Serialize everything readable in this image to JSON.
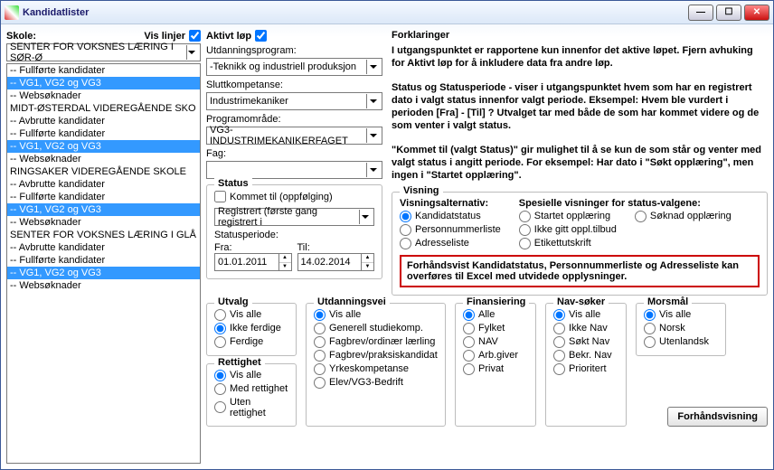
{
  "window": {
    "title": "Kandidatlister"
  },
  "left": {
    "skole_label": "Skole:",
    "vis_linjer_label": "Vis linjer",
    "skole_value": "SENTER FOR VOKSNES LÆRING I SØR-Ø",
    "items": [
      {
        "t": "-- Fullførte kandidater",
        "sel": false
      },
      {
        "t": "-- VG1, VG2 og VG3",
        "sel": true
      },
      {
        "t": "-- Websøknader",
        "sel": false
      },
      {
        "t": "MIDT-ØSTERDAL VIDEREGÅENDE SKO",
        "sel": false
      },
      {
        "t": "-- Avbrutte kandidater",
        "sel": false
      },
      {
        "t": "-- Fullførte kandidater",
        "sel": false
      },
      {
        "t": "-- VG1, VG2 og VG3",
        "sel": true
      },
      {
        "t": "-- Websøknader",
        "sel": false
      },
      {
        "t": "RINGSAKER VIDEREGÅENDE SKOLE",
        "sel": false
      },
      {
        "t": "-- Avbrutte kandidater",
        "sel": false
      },
      {
        "t": "-- Fullførte kandidater",
        "sel": false
      },
      {
        "t": "-- VG1, VG2 og VG3",
        "sel": true
      },
      {
        "t": "-- Websøknader",
        "sel": false
      },
      {
        "t": "SENTER FOR VOKSNES LÆRING I GLÅ",
        "sel": false
      },
      {
        "t": "-- Avbrutte kandidater",
        "sel": false
      },
      {
        "t": "-- Fullførte kandidater",
        "sel": false
      },
      {
        "t": "-- VG1, VG2 og VG3",
        "sel": true
      },
      {
        "t": "-- Websøknader",
        "sel": false
      }
    ]
  },
  "mid": {
    "aktivt_lop": "Aktivt løp",
    "utdanningsprogram_lbl": "Utdanningsprogram:",
    "utdanningsprogram_val": "-Teknikk og industriell produksjon",
    "sluttkompetanse_lbl": "Sluttkompetanse:",
    "sluttkompetanse_val": "Industrimekaniker",
    "programomrade_lbl": "Programområde:",
    "programomrade_val": "VG3-INDUSTRIMEKANIKERFAGET",
    "fag_lbl": "Fag:",
    "fag_val": "",
    "status_legend": "Status",
    "kommet_til": "Kommet til (oppfølging)",
    "status_val": "Registrert (første gang registrert i",
    "statusperiode": "Statusperiode:",
    "fra_lbl": "Fra:",
    "fra_val": "01.01.2011",
    "til_lbl": "Til:",
    "til_val": "14.02.2014"
  },
  "right": {
    "forklaringer": "Forklaringer",
    "p1": "I utgangspunktet er rapportene kun innenfor det aktive løpet. Fjern avhuking for Aktivt løp for å inkludere data fra andre løp.",
    "p2": "Status og Statusperiode - viser i utgangspunktet hvem som har en registrert dato i valgt status innenfor valgt periode. Eksempel: Hvem ble vurdert i perioden [Fra] - [Til] ? Utvalget tar med både de som har kommet videre og de som venter i valgt status.",
    "p3": "\"Kommet til (valgt Status)\" gir mulighet til å se kun de som står og venter med valgt status i angitt periode. For eksempel: Har dato i \"Søkt opplæring\", men ingen i \"Startet opplæring\".",
    "visning_legend": "Visning",
    "visningsalternativ": "Visningsalternativ:",
    "visopt": [
      "Kandidatstatus",
      "Personnummerliste",
      "Adresseliste"
    ],
    "spes_head": "Spesielle visninger for status-valgene:",
    "spes_col1": [
      "Startet opplæring",
      "Ikke gitt oppl.tilbud",
      "Etikettutskrift"
    ],
    "spes_col2": [
      "Søknad opplæring"
    ],
    "red_note": "Forhåndsvist Kandidatstatus, Personnummerliste og Adresseliste kan overføres til Excel med utvidede opplysninger.",
    "preview_btn": "Forhåndsvisning"
  },
  "groups": {
    "utvalg": {
      "legend": "Utvalg",
      "opts": [
        "Vis alle",
        "Ikke ferdige",
        "Ferdige"
      ],
      "sel": 1
    },
    "rettighet": {
      "legend": "Rettighet",
      "opts": [
        "Vis alle",
        "Med rettighet",
        "Uten rettighet"
      ],
      "sel": 0
    },
    "utdanningsvei": {
      "legend": "Utdanningsvei",
      "opts": [
        "Vis alle",
        "Generell studiekomp.",
        "Fagbrev/ordinær lærling",
        "Fagbrev/praksiskandidat",
        "Yrkeskompetanse",
        "Elev/VG3-Bedrift"
      ],
      "sel": 0
    },
    "finansiering": {
      "legend": "Finansiering",
      "opts": [
        "Alle",
        "Fylket",
        "NAV",
        "Arb.giver",
        "Privat"
      ],
      "sel": 0
    },
    "navsoker": {
      "legend": "Nav-søker",
      "opts": [
        "Vis alle",
        "Ikke Nav",
        "Søkt Nav",
        "Bekr. Nav",
        "Prioritert"
      ],
      "sel": 0
    },
    "morsmal": {
      "legend": "Morsmål",
      "opts": [
        "Vis alle",
        "Norsk",
        "Utenlandsk"
      ],
      "sel": 0
    }
  }
}
